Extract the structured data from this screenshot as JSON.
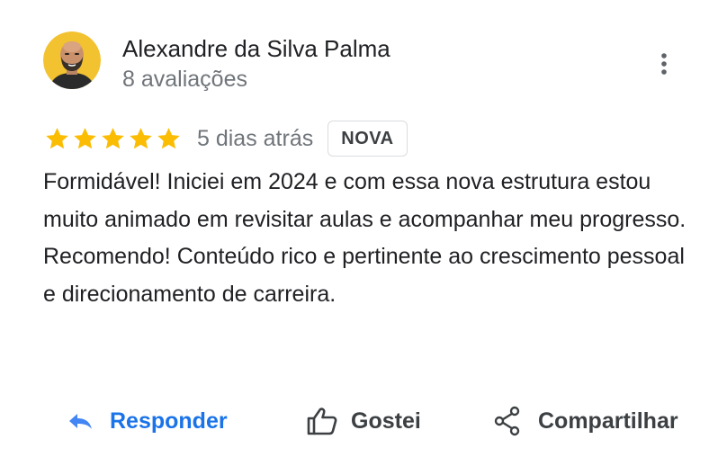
{
  "review": {
    "author": {
      "name": "Alexandre da Silva Palma",
      "meta": "8 avaliações",
      "avatar_icon": "avatar-photo"
    },
    "rating": 5,
    "rating_max": 5,
    "date": "5 dias atrás",
    "badge": "NOVA",
    "text": "Formidável! Iniciei em 2024 e com essa nova estrutura estou muito animado em revisitar aulas e acompanhar meu progresso. Recomendo! Conteúdo rico e pertinente ao crescimento pessoal e direcionamento de carreira."
  },
  "actions": {
    "reply": "Responder",
    "like": "Gostei",
    "share": "Compartilhar"
  },
  "icons": {
    "more": "more-vert-icon",
    "reply": "reply-icon",
    "like": "thumb-up-icon",
    "share": "share-icon",
    "star": "star-icon"
  },
  "colors": {
    "star": "#fbbc04",
    "link": "#1a73e8",
    "text": "#202124",
    "muted": "#70757a",
    "avatar_bg": "#f2c230"
  }
}
